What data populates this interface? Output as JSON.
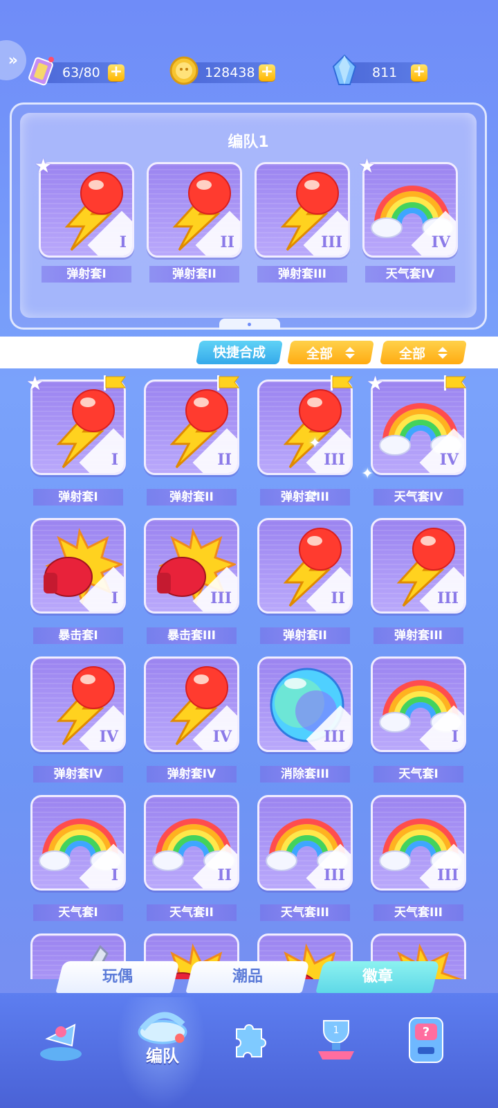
{
  "currencies": {
    "stamina": {
      "value": "63/80",
      "icon": "ticket-icon"
    },
    "coins": {
      "value": "128438",
      "icon": "coin-icon"
    },
    "gems": {
      "value": "811",
      "icon": "crystal-icon"
    }
  },
  "team": {
    "title": "编队1",
    "slots": [
      {
        "label": "弹射套I",
        "roman": "I",
        "art": "bolt-ball",
        "star": true
      },
      {
        "label": "弹射套II",
        "roman": "II",
        "art": "bolt-ball",
        "star": false
      },
      {
        "label": "弹射套III",
        "roman": "III",
        "art": "bolt-ball",
        "star": false
      },
      {
        "label": "天气套IV",
        "roman": "IV",
        "art": "rainbow",
        "star": true
      }
    ]
  },
  "filters": {
    "quick_label": "快捷合成",
    "filter1": "全部",
    "filter2": "全部"
  },
  "grid": [
    {
      "label": "弹射套I",
      "roman": "I",
      "art": "bolt-ball",
      "star": true,
      "flag": true
    },
    {
      "label": "弹射套II",
      "roman": "II",
      "art": "bolt-ball",
      "star": false,
      "flag": true
    },
    {
      "label": "弹射套III",
      "roman": "III",
      "art": "bolt-ball",
      "star": false,
      "flag": true
    },
    {
      "label": "天气套IV",
      "roman": "IV",
      "art": "rainbow",
      "star": true,
      "flag": true
    },
    {
      "label": "暴击套I",
      "roman": "I",
      "art": "glove",
      "star": false,
      "flag": false
    },
    {
      "label": "暴击套III",
      "roman": "III",
      "art": "glove",
      "star": false,
      "flag": false
    },
    {
      "label": "弹射套II",
      "roman": "II",
      "art": "bolt-ball",
      "star": false,
      "flag": false
    },
    {
      "label": "弹射套III",
      "roman": "III",
      "art": "bolt-ball",
      "star": false,
      "flag": false
    },
    {
      "label": "弹射套IV",
      "roman": "IV",
      "art": "bolt-ball",
      "star": false,
      "flag": false
    },
    {
      "label": "弹射套IV",
      "roman": "IV",
      "art": "bolt-ball",
      "star": false,
      "flag": false
    },
    {
      "label": "消除套III",
      "roman": "III",
      "art": "orb",
      "star": false,
      "flag": false
    },
    {
      "label": "天气套I",
      "roman": "I",
      "art": "rainbow",
      "star": false,
      "flag": false
    },
    {
      "label": "天气套I",
      "roman": "I",
      "art": "rainbow",
      "star": false,
      "flag": false
    },
    {
      "label": "天气套II",
      "roman": "II",
      "art": "rainbow",
      "star": false,
      "flag": false
    },
    {
      "label": "天气套III",
      "roman": "III",
      "art": "rainbow",
      "star": false,
      "flag": false
    },
    {
      "label": "天气套III",
      "roman": "III",
      "art": "rainbow",
      "star": false,
      "flag": false
    },
    {
      "label": "",
      "roman": "",
      "art": "blade",
      "star": false,
      "flag": false
    },
    {
      "label": "",
      "roman": "",
      "art": "glove",
      "star": false,
      "flag": false
    },
    {
      "label": "",
      "roman": "",
      "art": "glove",
      "star": false,
      "flag": false
    },
    {
      "label": "",
      "roman": "",
      "art": "glove",
      "star": false,
      "flag": false
    }
  ],
  "category_tabs": [
    {
      "label": "玩偶",
      "active": false
    },
    {
      "label": "潮品",
      "active": false
    },
    {
      "label": "徽章",
      "active": true
    }
  ],
  "bottom_nav": [
    {
      "name": "nav-figure",
      "icon": "figure-icon",
      "label": "",
      "active": false
    },
    {
      "name": "nav-team",
      "icon": "whistle-icon",
      "label": "编队",
      "active": true
    },
    {
      "name": "nav-puzzle",
      "icon": "puzzle-icon",
      "label": "",
      "active": false
    },
    {
      "name": "nav-trophy",
      "icon": "trophy-icon",
      "label": "",
      "active": false
    },
    {
      "name": "nav-gacha",
      "icon": "gacha-machine-icon",
      "label": "",
      "active": false
    }
  ],
  "colors": {
    "accent": "#6f8cf8",
    "gold": "#ffb600",
    "cyan": "#5fd8e7",
    "card": "#a592f5"
  }
}
